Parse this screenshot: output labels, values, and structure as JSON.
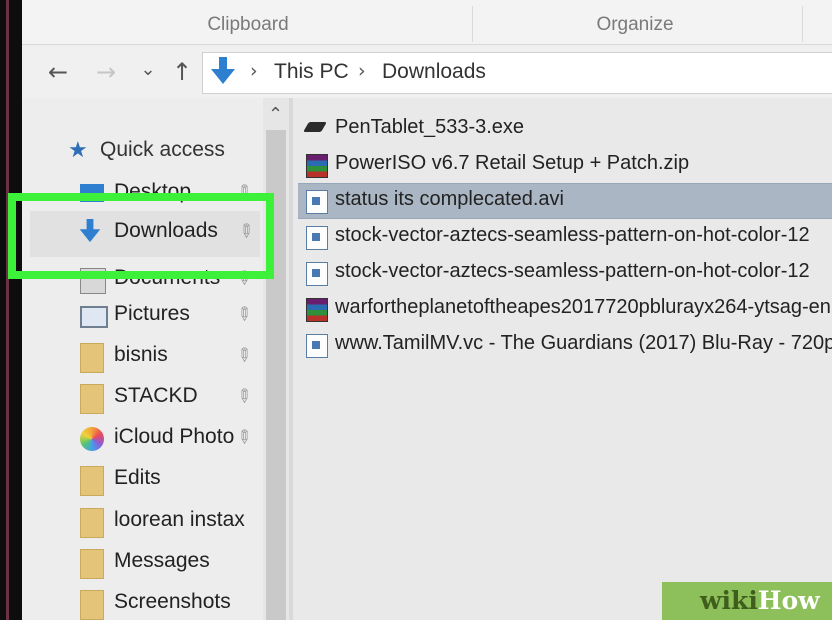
{
  "ribbon": {
    "groups": [
      "Clipboard",
      "Organize"
    ]
  },
  "address_bar": {
    "back_glyph": "←",
    "forward_glyph": "→",
    "recent_glyph": "⌄",
    "up_glyph": "↑",
    "location_icon": "download-arrow-icon",
    "crumbs": [
      "This PC",
      "Downloads"
    ],
    "separator": "›"
  },
  "nav_pane": {
    "quick_access": "Quick access",
    "items": [
      {
        "label": "Desktop",
        "icon": "desktop-icon",
        "pinned": true
      },
      {
        "label": "Downloads",
        "icon": "download-arrow-icon",
        "pinned": true,
        "highlighted": true
      },
      {
        "label": "Documents",
        "icon": "documents-icon",
        "pinned": true
      },
      {
        "label": "Pictures",
        "icon": "pictures-icon",
        "pinned": true
      },
      {
        "label": "bisnis",
        "icon": "folder-icon",
        "pinned": true
      },
      {
        "label": "STACKD",
        "icon": "folder-icon",
        "pinned": true
      },
      {
        "label": "iCloud Photo",
        "icon": "icloud-photos-icon",
        "pinned": true
      },
      {
        "label": "Edits",
        "icon": "folder-icon",
        "pinned": false
      },
      {
        "label": "loorean instax",
        "icon": "folder-icon",
        "pinned": false
      },
      {
        "label": "Messages",
        "icon": "folder-icon",
        "pinned": false
      },
      {
        "label": "Screenshots",
        "icon": "folder-icon",
        "pinned": false
      }
    ],
    "pin_glyph": "📌"
  },
  "files": [
    {
      "name": "PenTablet_533-3.exe",
      "icon": "exe-icon",
      "selected": false
    },
    {
      "name": "PowerISO v6.7 Retail Setup + Patch.zip",
      "icon": "winrar-icon",
      "selected": false
    },
    {
      "name": "status its complecated.avi",
      "icon": "video-file-icon",
      "selected": true
    },
    {
      "name": "stock-vector-aztecs-seamless-pattern-on-hot-color-12",
      "icon": "image-file-icon",
      "selected": false
    },
    {
      "name": "stock-vector-aztecs-seamless-pattern-on-hot-color-12",
      "icon": "image-file-icon",
      "selected": false
    },
    {
      "name": "warfortheplanetoftheapes2017720pblurayx264-ytsag-en",
      "icon": "winrar-icon",
      "selected": false
    },
    {
      "name": "www.TamilMV.vc - The Guardians (2017) Blu-Ray - 720p",
      "icon": "video-file-icon",
      "selected": false
    }
  ],
  "watermark": {
    "wiki": "wiki",
    "how": "How"
  },
  "colors": {
    "highlight_green": "#3df03a",
    "selected_row": "#aab6c3",
    "accent_blue": "#2f7fd0"
  }
}
